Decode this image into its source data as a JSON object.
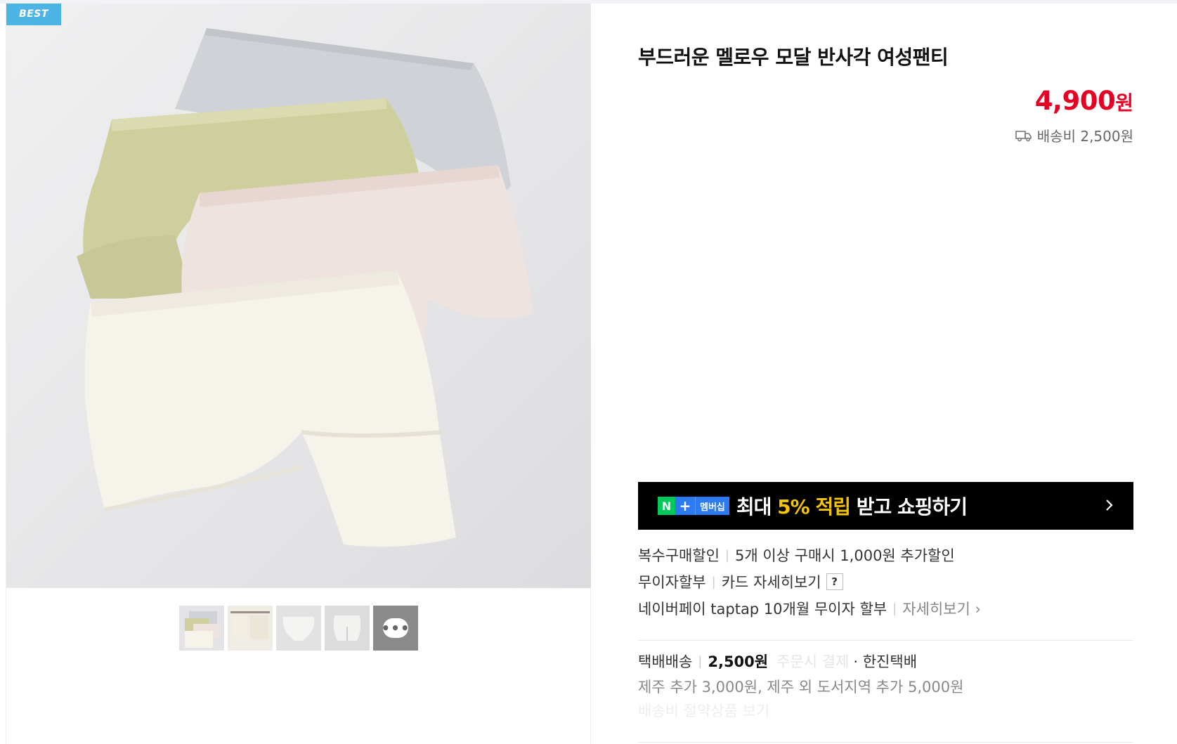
{
  "badge": {
    "label": "BEST"
  },
  "product": {
    "title": "부드러운 멜로우 모달 반사각 여성팬티",
    "price": "4,900",
    "price_unit": "원",
    "shipping": "배송비 2,500원"
  },
  "thumbnails": {
    "count": 5,
    "more_label": "•••"
  },
  "membership": {
    "badge_n": "N",
    "badge_plus": "+",
    "badge_label": "멤버십",
    "text_before": "최대 ",
    "text_highlight": "5% 적립",
    "text_after": " 받고 쇼핑하기"
  },
  "benefits": {
    "multi_discount_label": "복수구매할인",
    "multi_discount_value": "5개 이상 구매시 1,000원 추가할인",
    "installment_label": "무이자할부",
    "installment_value": "카드 자세히보기",
    "installment_help": "?",
    "naverpay_text": "네이버페이 taptap 10개월 무이자 할부",
    "naverpay_link": "자세히보기 ›"
  },
  "delivery": {
    "type_label": "택배배송",
    "price": "2,500원",
    "faded_text": "주문시 결제",
    "courier": "· 한진택배",
    "extra": "제주 추가 3,000원, 제주 외 도서지역 추가 5,000원",
    "faded_line": "배송비 절약상품 보기"
  },
  "colors": {
    "price_red": "#e60023",
    "best_blue": "#4db4e6",
    "naver_green": "#03c75a",
    "highlight_yellow": "#f5c400"
  }
}
